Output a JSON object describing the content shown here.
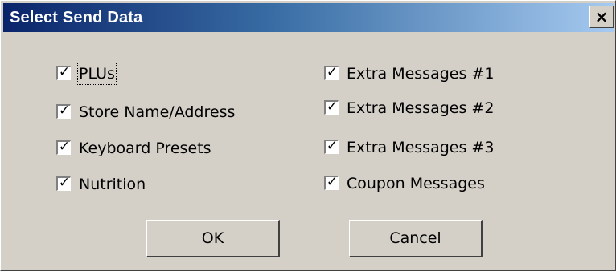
{
  "window": {
    "title": "Select Send Data",
    "close_glyph": "×",
    "close_icon": "close-icon"
  },
  "check_glyph": "✓",
  "left_column": [
    {
      "label": "PLUs",
      "checked": true
    },
    {
      "label": "Store Name/Address",
      "checked": true
    },
    {
      "label": "Keyboard Presets",
      "checked": true
    },
    {
      "label": "Nutrition",
      "checked": true
    }
  ],
  "right_column": [
    {
      "label": "Extra Messages #1",
      "checked": true
    },
    {
      "label": "Extra Messages #2",
      "checked": true
    },
    {
      "label": "Extra Messages #3",
      "checked": true
    },
    {
      "label": "Coupon Messages",
      "checked": true
    }
  ],
  "buttons": {
    "ok": "OK",
    "cancel": "Cancel"
  }
}
